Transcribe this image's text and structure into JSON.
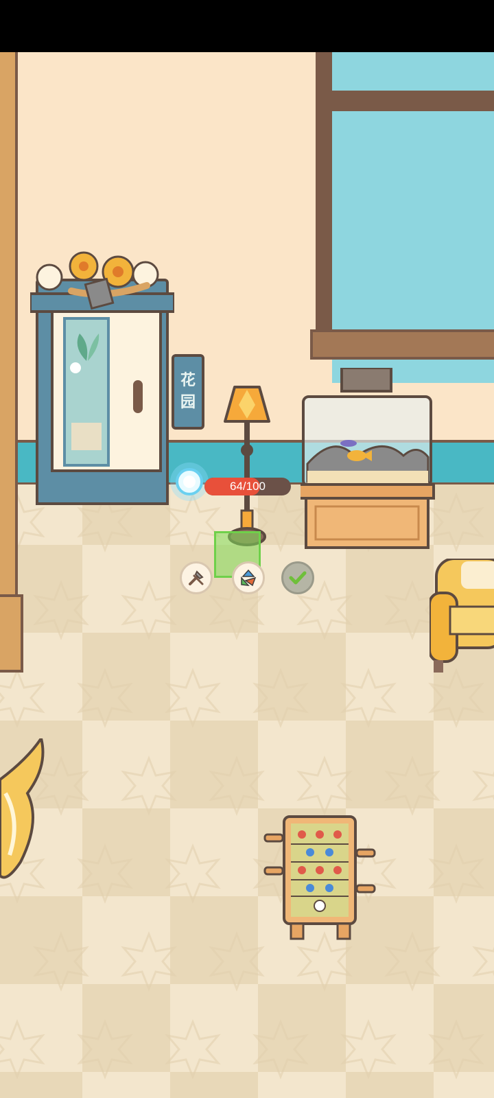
{
  "garden_sign": {
    "chars": [
      "花",
      "园"
    ]
  },
  "furniture_status": {
    "hp_text": "64/100",
    "hp_fraction": 0.64
  },
  "action_buttons": [
    {
      "icon": "tools-icon"
    },
    {
      "icon": "recycle-icon"
    },
    {
      "icon": "checkmark-icon"
    }
  ],
  "colors": {
    "wall": "#fbe5c8",
    "baseboard": "#49b8c4",
    "window_glass": "#8ed6df",
    "hp_fill": "#e8503a",
    "confirm_check": "#6fbf3a"
  }
}
